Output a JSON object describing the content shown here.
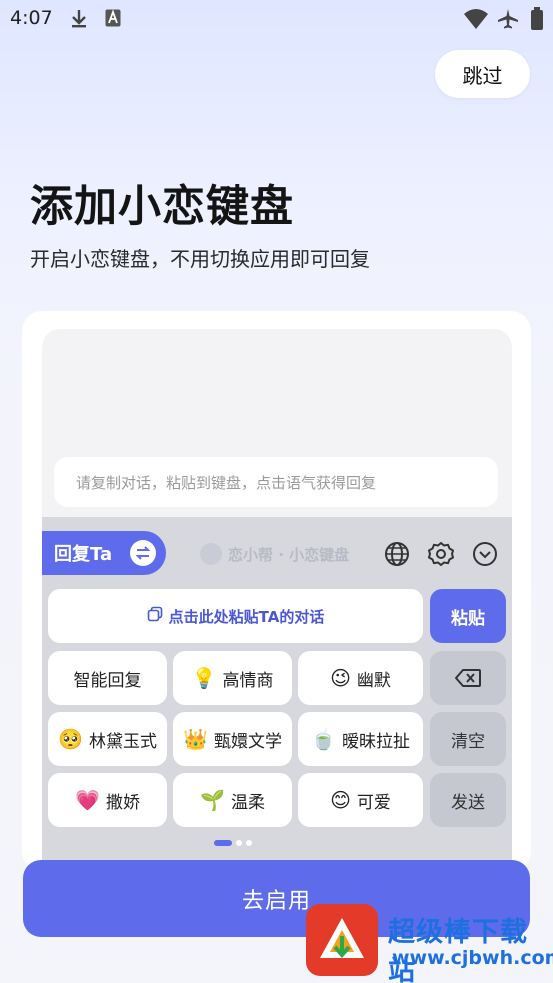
{
  "status_bar": {
    "time": "4:07"
  },
  "header": {
    "skip_label": "跳过"
  },
  "title": "添加小恋键盘",
  "subtitle": "开启小恋键盘，不用切换应用即可回复",
  "preview": {
    "input_placeholder": "请复制对话，粘贴到键盘，点击语气获得回复",
    "keyboard": {
      "reply_tab_label": "回复Ta",
      "brand_watermark": "恋小帮 · 小恋键盘",
      "paste_area_label": "点击此处粘贴TA的对话",
      "paste_key": "粘贴",
      "clear_key": "清空",
      "send_key": "发送",
      "tone_keys": [
        {
          "emoji": "",
          "label": "智能回复"
        },
        {
          "emoji": "💡",
          "label": "高情商"
        },
        {
          "emoji": "😉",
          "label": "幽默"
        },
        {
          "emoji": "🥺",
          "label": "林黛玉式"
        },
        {
          "emoji": "👑",
          "label": "甄嬛文学"
        },
        {
          "emoji": "🍵",
          "label": "暧昧拉扯"
        },
        {
          "emoji": "💗",
          "label": "撒娇"
        },
        {
          "emoji": "🌱",
          "label": "温柔"
        },
        {
          "emoji": "😊",
          "label": "可爱"
        }
      ]
    }
  },
  "enable_button_label": "去启用",
  "watermark": {
    "name": "超级棒下载站",
    "url": "www.cjbwh.com"
  },
  "colors": {
    "accent": "#5e6cec",
    "background": "#f4f5fb",
    "keyboard_bg": "#d6d8de"
  }
}
